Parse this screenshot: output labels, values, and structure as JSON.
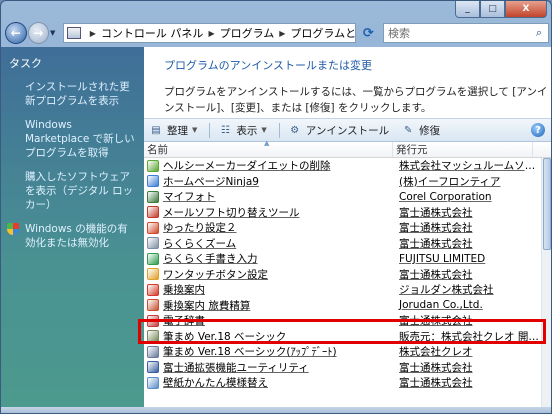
{
  "window": {
    "minimize": "_",
    "maximize": "□",
    "close": "X"
  },
  "address": {
    "breadcrumbs": [
      "コントロール パネル",
      "プログラム",
      "プログラムと機能"
    ],
    "search_placeholder": "検索"
  },
  "tasks": {
    "title": "タスク",
    "links": [
      "インストールされた更新プログラムを表示",
      "Windows Marketplace で新しいプログラムを取得",
      "購入したソフトウェアを表示（デジタル ロッカー）",
      "Windows の機能の有効化または無効化"
    ]
  },
  "main": {
    "heading": "プログラムのアンインストールまたは変更",
    "description": "プログラムをアンインストールするには、一覧からプログラムを選択して [アンインストール]、[変更]、または [修復] をクリックします。"
  },
  "toolbar": {
    "organize": "整理",
    "view": "表示",
    "uninstall": "アンインストール",
    "repair": "修復",
    "help": "?"
  },
  "list": {
    "col_name": "名前",
    "col_publisher": "発行元",
    "rows": [
      {
        "name": "ヘルシーメーカーダイエットの削除",
        "publisher": "株式会社マッシュルームソフト",
        "color": "#5aa832"
      },
      {
        "name": "ホームページNinja9",
        "publisher": "(株)イーフロンティア",
        "color": "#3b7fd4"
      },
      {
        "name": "マイフォト",
        "publisher": "Corel Corporation",
        "color": "#3c7a3c"
      },
      {
        "name": "メールソフト切り替えツール",
        "publisher": "富士通株式会社",
        "color": "#c23b2a"
      },
      {
        "name": "ゆったり設定２",
        "publisher": "富士通株式会社",
        "color": "#d04a2a"
      },
      {
        "name": "らくらくズーム",
        "publisher": "富士通株式会社",
        "color": "#7f8fa3"
      },
      {
        "name": "らくらく手書き入力",
        "publisher": "FUJITSU LIMITED",
        "color": "#2f9c4f"
      },
      {
        "name": "ワンタッチボタン設定",
        "publisher": "富士通株式会社",
        "color": "#e0a12a"
      },
      {
        "name": "乗換案内",
        "publisher": "ジョルダン株式会社",
        "color": "#d23b2a"
      },
      {
        "name": "乗換案内 旅費精算",
        "publisher": "Jorudan Co.,Ltd.",
        "color": "#c9502f"
      },
      {
        "name": "電子辞書",
        "publisher": "富士通株式会社",
        "color": "#c43c3c"
      },
      {
        "name": "筆まめ Ver.18 ベーシック",
        "publisher": "販売元：株式会社クレオ 開発元：...",
        "color": "#7a8a5a"
      },
      {
        "name": "筆まめ Ver.18 ベーシック(ｱｯﾌﾟﾃﾞｰﾄ)",
        "publisher": "株式会社クレオ",
        "color": "#6a7a9a"
      },
      {
        "name": "富士通拡張機能ユーティリティ",
        "publisher": "富士通株式会社",
        "color": "#3a5fa0"
      },
      {
        "name": "壁紙かんたん模様替え",
        "publisher": "富士通株式会社",
        "color": "#5b8fc7"
      }
    ]
  }
}
